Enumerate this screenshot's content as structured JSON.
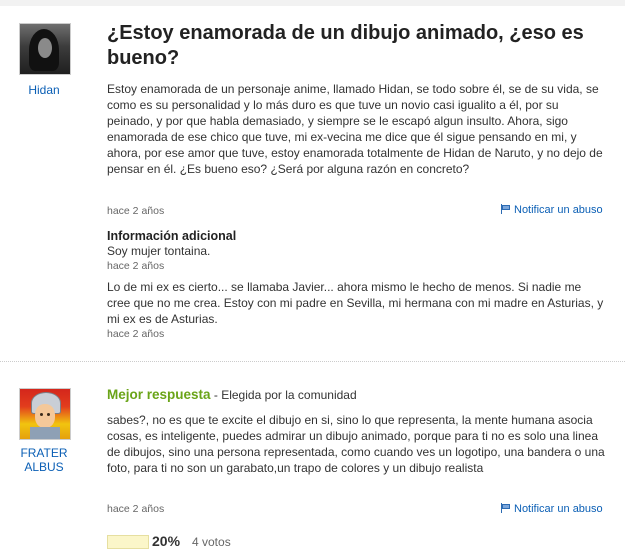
{
  "question": {
    "username": "Hidan",
    "title": "¿Estoy enamorada de un dibujo animado, ¿eso es bueno?",
    "body": "Estoy enamorada de un personaje anime, llamado Hidan, se todo sobre él, se de su vida, se como es su personalidad y lo más duro es que tuve un novio casi igualito a él, por su peinado, y por que habla demasiado, y siempre se le escapó algun insulto. Ahora, sigo enamorada de ese chico que tuve, mi ex-vecina me dice que él sigue pensando en mi, y ahora, por ese amor que tuve, estoy enamorada totalmente de Hidan de Naruto, y no dejo de pensar en él. ¿Es bueno eso? ¿Será por alguna razón en concreto?",
    "time": "hace 2 años",
    "report_label": "Notificar un abuso",
    "additional_info": {
      "heading": "Información adicional",
      "entries": [
        {
          "text": "Soy mujer tontaina.",
          "time": "hace 2 años"
        },
        {
          "text": "Lo de mi ex es cierto... se llamaba Javier... ahora mismo le hecho de menos. Si nadie me cree que no me crea. Estoy con mi padre en Sevilla, mi hermana con mi madre en Asturias, y mi ex es de Asturias.",
          "time": "hace 2 años"
        }
      ]
    }
  },
  "best_answer": {
    "username": "FRATER ALBUS",
    "label": "Mejor respuesta",
    "chosen_by": " - Elegida por la comunidad",
    "body": "sabes?, no es que te excite el dibujo en si, sino lo que representa, la mente humana asocia cosas, es inteligente, puedes admirar un dibujo animado, porque para ti no es solo una linea de dibujos, sino una persona representada, como cuando ves un logotipo, una bandera o una foto, para ti no son un garabato,un trapo de colores y un dibujo realista",
    "time": "hace 2 años",
    "report_label": "Notificar un abuso",
    "vote_percent": "20%",
    "vote_count": "4 votos",
    "vote_percent_value": 20
  },
  "colors": {
    "link": "#0b5fb5",
    "best_answer": "#6aa418",
    "text": "#333333"
  },
  "icons": {
    "report": "flag-icon",
    "question_avatar": "avatar-icon",
    "answer_avatar": "avatar-icon"
  }
}
